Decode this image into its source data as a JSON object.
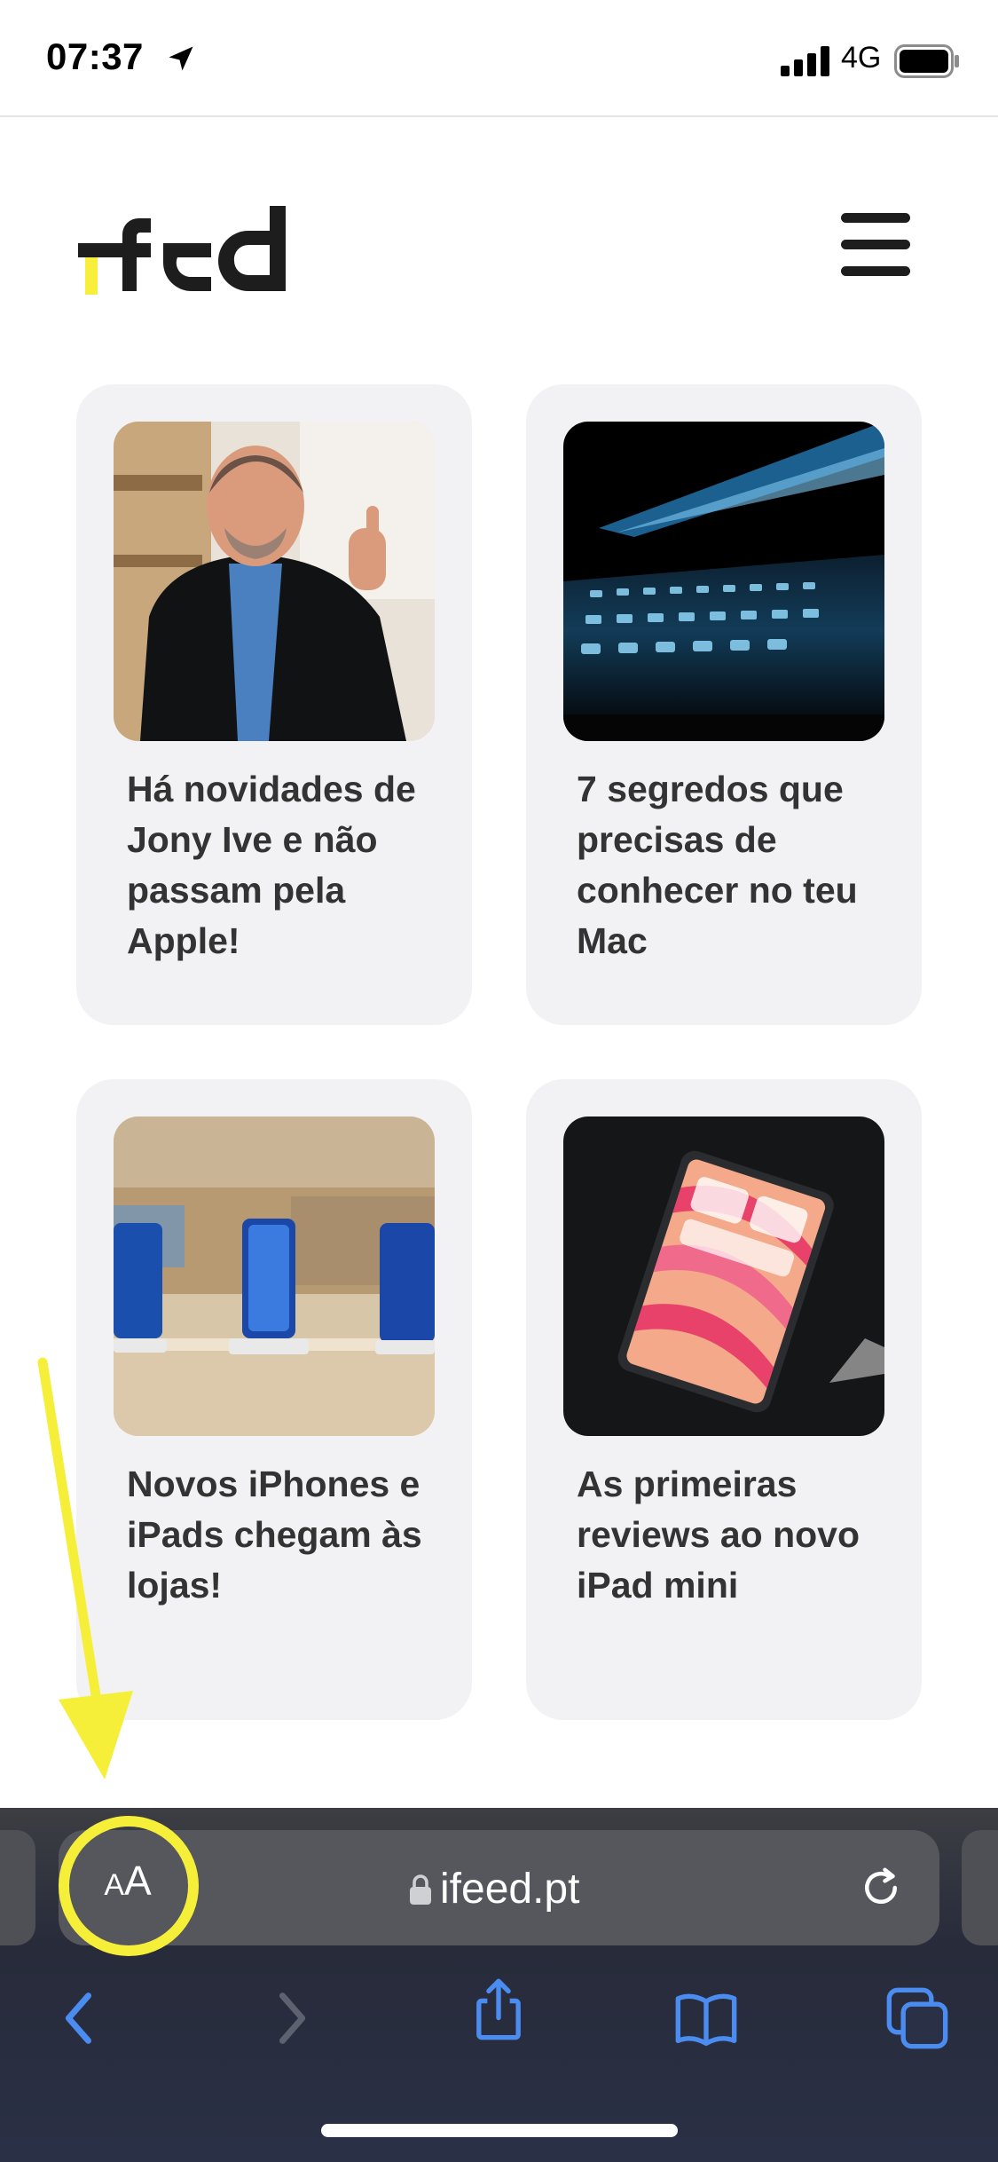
{
  "status_bar": {
    "time": "07:37",
    "network": "4G",
    "icons": [
      "location-arrow-icon",
      "cellular-signal-icon",
      "battery-icon"
    ]
  },
  "site": {
    "logo_text": "feed",
    "logo_accent_color": "#f7ef3c",
    "menu_icon": "hamburger-menu-icon"
  },
  "articles": [
    {
      "title": "Há novidades de Jony Ive e não passam pela Apple!",
      "image": "photo of man in black coat giving thumbs up"
    },
    {
      "title": "7 segredos que precisas de conhecer no teu Mac",
      "image": "close-up of blue-lit laptop keyboard"
    },
    {
      "title": "Novos iPhones e iPads chegam às lojas!",
      "image": "blue iPhones on display stands in store"
    },
    {
      "title": "As primeiras reviews ao novo iPad mini",
      "image": "iPad mini with pink wallpaper on dark background"
    }
  ],
  "browser": {
    "reader_button_small": "A",
    "reader_button_big": "A",
    "url": "ifeed.pt",
    "toolbar": [
      "back-icon",
      "forward-icon",
      "share-icon",
      "bookmarks-icon",
      "tabs-icon"
    ],
    "accent_color": "#4a8cf0"
  },
  "annotation": {
    "color": "#f6ef3a"
  }
}
